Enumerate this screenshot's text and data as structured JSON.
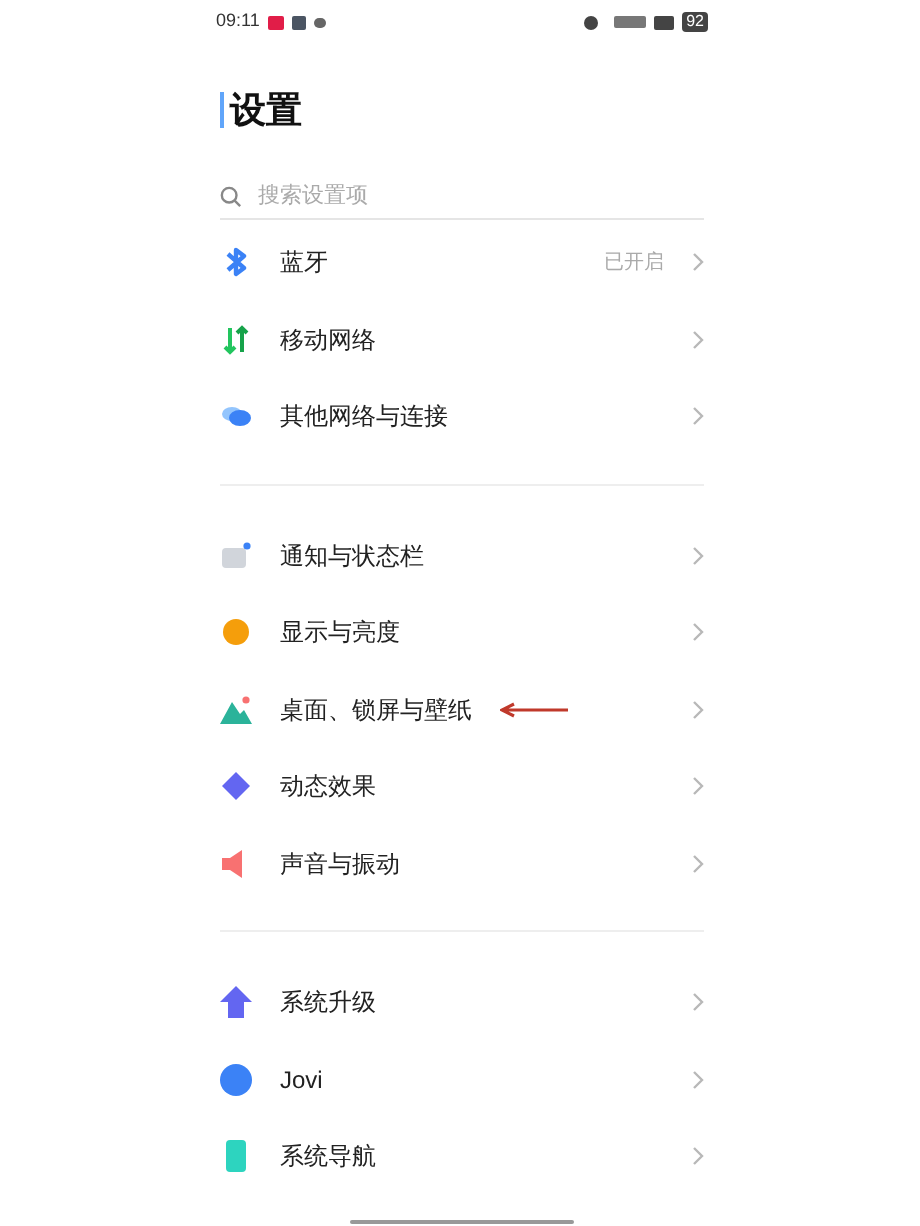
{
  "status_bar": {
    "time": "09:11",
    "battery": "92"
  },
  "title": "设置",
  "search": {
    "placeholder": "搜索设置项"
  },
  "groups": [
    {
      "items": [
        {
          "kind": "bluetooth",
          "label": "蓝牙",
          "value": "已开启",
          "arrow_mark": false
        },
        {
          "kind": "mobile",
          "label": "移动网络",
          "arrow_mark": false
        },
        {
          "kind": "network",
          "label": "其他网络与连接",
          "arrow_mark": false
        }
      ]
    },
    {
      "items": [
        {
          "kind": "notification",
          "label": "通知与状态栏",
          "arrow_mark": false
        },
        {
          "kind": "display",
          "label": "显示与亮度",
          "arrow_mark": false
        },
        {
          "kind": "wallpaper",
          "label": "桌面、锁屏与壁纸",
          "arrow_mark": true
        },
        {
          "kind": "effects",
          "label": "动态效果",
          "arrow_mark": false
        },
        {
          "kind": "sound",
          "label": "声音与振动",
          "arrow_mark": false
        }
      ]
    },
    {
      "items": [
        {
          "kind": "upgrade",
          "label": "系统升级",
          "arrow_mark": false
        },
        {
          "kind": "jovi",
          "label": "Jovi",
          "arrow_mark": false
        },
        {
          "kind": "navigation",
          "label": "系统导航",
          "arrow_mark": false
        }
      ]
    }
  ]
}
